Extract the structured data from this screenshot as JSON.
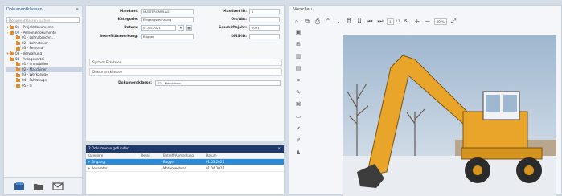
{
  "left": {
    "title": "Dokumentklassen",
    "collapse": "«",
    "search_placeholder": "Dokumentklassen suchen...",
    "tree": [
      {
        "twisty": "+",
        "label": "01 - Projektdokumente",
        "color": "orange",
        "indent": 0
      },
      {
        "twisty": "-",
        "label": "02 - Personaldokumente",
        "color": "orange",
        "indent": 0
      },
      {
        "twisty": "",
        "label": "01 - Lohnabrechn...",
        "color": "orange",
        "indent": 1
      },
      {
        "twisty": "",
        "label": "02 - Lohnsteuer",
        "color": "orange",
        "indent": 1
      },
      {
        "twisty": "",
        "label": "03 - Personal",
        "color": "orange",
        "indent": 1
      },
      {
        "twisty": "+",
        "label": "03 - Verwaltung",
        "color": "orange",
        "indent": 0
      },
      {
        "twisty": "-",
        "label": "04 - Anlagekartei",
        "color": "orange",
        "indent": 0
      },
      {
        "twisty": "",
        "label": "01 - Immobilien",
        "color": "orange",
        "indent": 1
      },
      {
        "twisty": "",
        "label": "02 - Maschinen",
        "color": "orange",
        "indent": 1,
        "selected": true
      },
      {
        "twisty": "",
        "label": "03 - Werkzeuge",
        "color": "orange",
        "indent": 1
      },
      {
        "twisty": "",
        "label": "04 - Fahrzeuge",
        "color": "orange",
        "indent": 1
      },
      {
        "twisty": "",
        "label": "05 - IT",
        "color": "orange",
        "indent": 1
      }
    ],
    "footer_icons": [
      "archive-icon",
      "folder-icon",
      "mail-icon"
    ]
  },
  "form": {
    "mandant_label": "Mandant:",
    "mandant_value": "MUSTERGMULAG",
    "kategorie_label": "Kategorie:",
    "kategorie_value": "Eingangsrechnung",
    "datum_label": "Datum:",
    "datum_value": "01.03.2021",
    "betreff_label": "Betreff/Anmerkung:",
    "betreff_value": "Bagger",
    "mandant_id_label": "Mandant ID:",
    "mandant_id_value": "1",
    "ortabt_label": "Ort/Abt:",
    "ortabt_value": "",
    "geschaeftsjahr_label": "Geschäftsjahr:",
    "geschaeftsjahr_value": "2021",
    "dms_id_label": "DMS-ID:",
    "dms_id_value": "",
    "sections": [
      "System Eckdaten",
      "Dokumentklassen"
    ],
    "dokklasse_label": "Dokumentklasse:",
    "dokklasse_value": "02 - Maschinen"
  },
  "results": {
    "title": "2 Dokumente gefunden",
    "close": "×",
    "columns": [
      "Kategorie",
      "Detail",
      "Betreff/Anmerkung",
      "Datum"
    ],
    "rows": [
      {
        "kategorie": "+ Eingang",
        "detail": "",
        "betreff": "Bagger",
        "datum": "01.03.2021",
        "selected": true
      },
      {
        "kategorie": "+ Reparatur",
        "detail": "",
        "betreff": "Motorwechsel",
        "datum": "01.04.2021",
        "selected": false
      }
    ]
  },
  "viewer": {
    "title": "Vorschau",
    "page_current": "1",
    "page_total": "/ 1",
    "zoom": "80 %"
  },
  "colors": {
    "accent": "#1f3a6b",
    "selection": "#2c8bd6",
    "folder": "#e58b2b"
  }
}
